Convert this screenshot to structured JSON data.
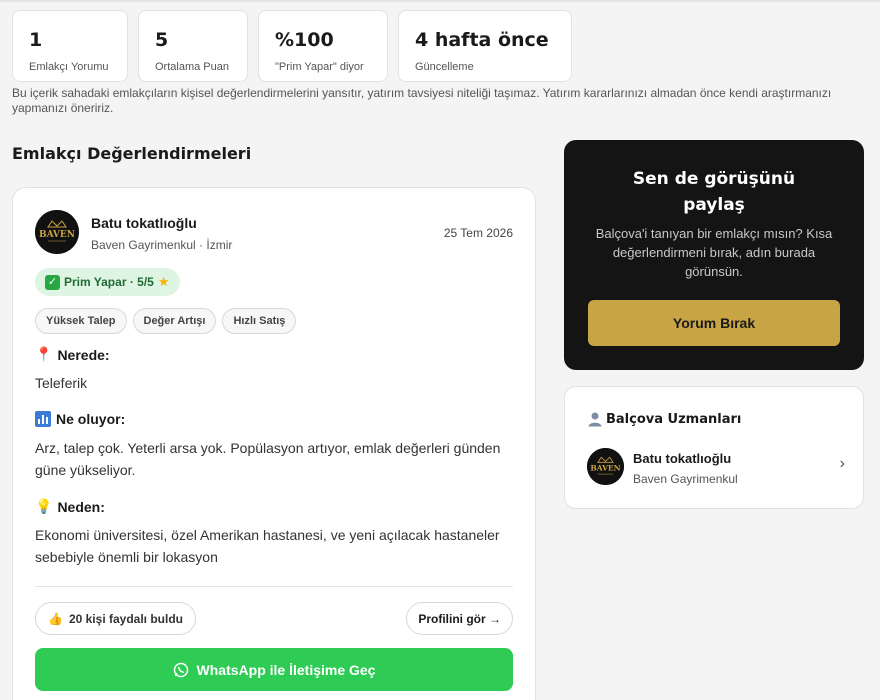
{
  "stats": [
    {
      "value": "1",
      "label": "Emlakçı Yorumu"
    },
    {
      "value": "5",
      "label": "Ortalama Puan"
    },
    {
      "value": "%100",
      "label": "\"Prim Yapar\" diyor"
    },
    {
      "value": "4 hafta önce",
      "label": "Güncelleme"
    }
  ],
  "disclaimer": "Bu içerik sahadaki emlakçıların kişisel değerlendirmelerini yansıtır, yatırım tavsiyesi niteliği taşımaz. Yatırım kararlarınızı almadan önce kendi araştırmanızı yapmanızı öneririz.",
  "section_title": "Emlakçı Değerlendirmeleri",
  "review": {
    "avatar_text": "BAVEN",
    "agent_name": "Batu tokatlıoğlu",
    "agency": "Baven Gayrimenkul · İzmir",
    "date": "25 Tem 2026",
    "verdict": "Prim Yapar · 5/5",
    "verdict_icon": "check-icon",
    "tags": [
      "Yüksek Talep",
      "Değer Artışı",
      "Hızlı Satış"
    ],
    "where_label": "Nerede:",
    "where_text": "Teleferik",
    "what_label": "Ne oluyor:",
    "what_text": "Arz, talep çok. Yeterli arsa yok. Popülasyon artıyor, emlak değerleri günden güne yükseliyor.",
    "why_label": "Neden:",
    "why_text": "Ekonomi üniversitesi, özel Amerikan hastanesi, ve yeni açılacak hastaneler sebebiyle önemli bir lokasyon",
    "helpful_label": "20 kişi faydalı buldu",
    "profile_label": "Profilini gör →",
    "whatsapp_label": "WhatsApp ile İletişime Geç"
  },
  "cta": {
    "title_line1": "Sen de görüşünü",
    "title_line2": "paylaş",
    "text": "Balçova'i tanıyan bir emlakçı mısın? Kısa değerlendirmeni bırak, adın burada görünsün.",
    "button": "Yorum Bırak"
  },
  "experts": {
    "title": "Balçova Uzmanları",
    "items": [
      {
        "name": "Batu tokatlıoğlu",
        "agency": "Baven Gayrimenkul"
      }
    ]
  },
  "colors": {
    "accent_gold": "#c9a445",
    "whatsapp_green": "#2ecc55",
    "badge_bg": "#dff5e3",
    "dark_card": "#141414"
  }
}
